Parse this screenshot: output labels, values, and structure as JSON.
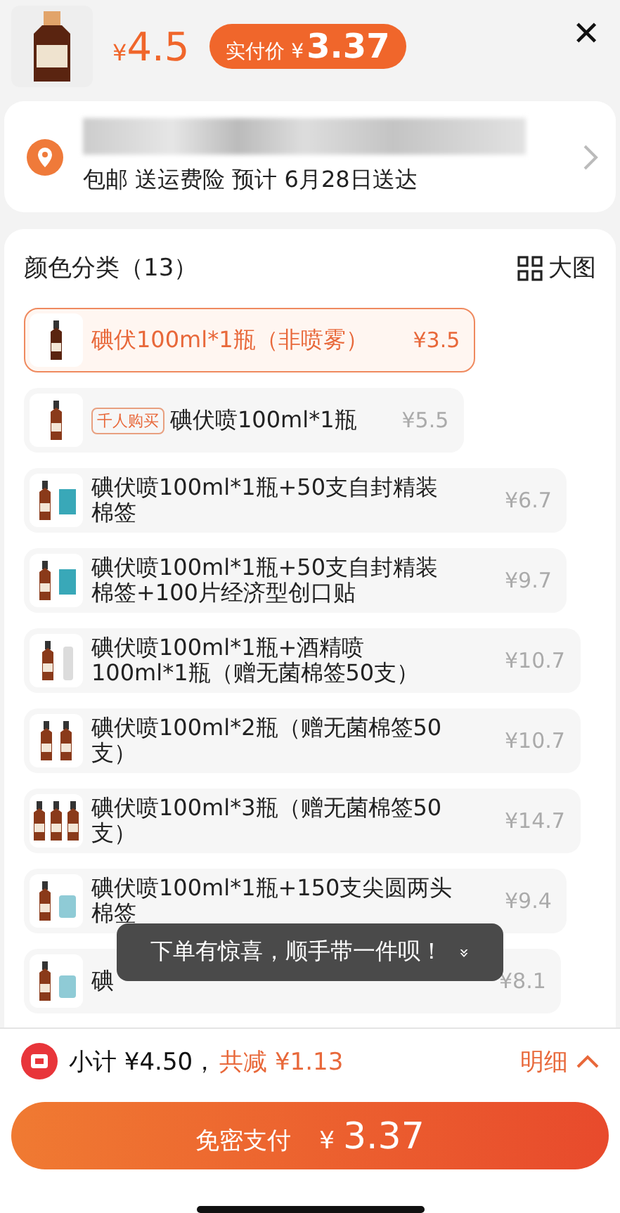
{
  "header": {
    "price_symbol": "¥",
    "price": "4.5",
    "paid_label": "实付价 ¥",
    "paid_price": "3.37",
    "close": "✕"
  },
  "address": {
    "shipping": "包邮  送运费险  预计 6月28日送达"
  },
  "options": {
    "title": "颜色分类（13）",
    "view_label": "大图",
    "items": [
      {
        "name": "碘伏100ml*1瓶（非喷雾）",
        "price": "¥3.5",
        "selected": true,
        "kind": "plain"
      },
      {
        "tag": "千人购买",
        "name": "碘伏喷100ml*1瓶",
        "price": "¥5.5",
        "selected": false,
        "kind": "spray"
      },
      {
        "name": "碘伏喷100ml*1瓶+50支自封精装棉签",
        "price": "¥6.7",
        "selected": false,
        "kind": "swab"
      },
      {
        "name": "碘伏喷100ml*1瓶+50支自封精装棉签+100片经济型创口贴",
        "price": "¥9.7",
        "selected": false,
        "kind": "swab"
      },
      {
        "name": "碘伏喷100ml*1瓶+酒精喷100ml*1瓶（赠无菌棉签50支）",
        "price": "¥10.7",
        "selected": false,
        "kind": "alcohol"
      },
      {
        "name": "碘伏喷100ml*2瓶（赠无菌棉签50支）",
        "price": "¥10.7",
        "selected": false,
        "kind": "double"
      },
      {
        "name": "碘伏喷100ml*3瓶（赠无菌棉签50支）",
        "price": "¥14.7",
        "selected": false,
        "kind": "triple"
      },
      {
        "name": "碘伏喷100ml*1瓶+150支尖圆两头棉签",
        "price": "¥9.4",
        "selected": false,
        "kind": "box"
      },
      {
        "name": "碘",
        "price": "¥8.1",
        "selected": false,
        "kind": "box"
      }
    ]
  },
  "toast": {
    "text": "下单有惊喜，顺手带一件呗！",
    "caret": "»"
  },
  "footer": {
    "subtotal": "小计 ¥4.50，",
    "discount": "共减 ¥1.13",
    "details": "明细",
    "pay_label": "免密支付",
    "pay_symbol": "¥",
    "pay_price": "3.37"
  }
}
